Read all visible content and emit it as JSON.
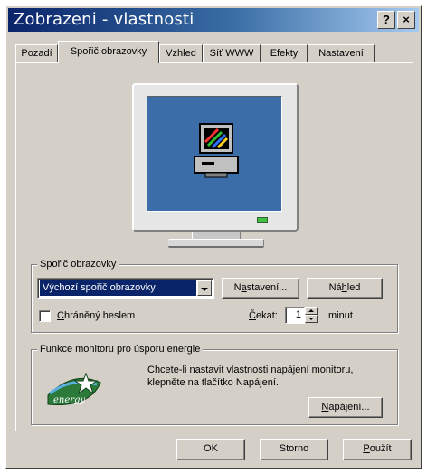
{
  "window": {
    "title": "Zobrazeni - vlastnosti",
    "help_label": "?",
    "close_label": "×"
  },
  "tabs": [
    {
      "label": "Pozadí",
      "active": false
    },
    {
      "label": "Spořič obrazovky",
      "active": true
    },
    {
      "label": "Vzhled",
      "active": false
    },
    {
      "label": "Síť WWW",
      "active": false
    },
    {
      "label": "Efekty",
      "active": false
    },
    {
      "label": "Nastavení",
      "active": false
    }
  ],
  "screensaver": {
    "group_label": "Spořič obrazovky",
    "selected": "Výchozí spořič obrazovky",
    "settings_button": {
      "pre": "N",
      "ul": "a",
      "post": "stavení..."
    },
    "preview_button": {
      "pre": "Ná",
      "ul": "h",
      "post": "led"
    },
    "password_checkbox": {
      "pre": "",
      "ul": "C",
      "post": "hráněný heslem",
      "checked": false
    },
    "wait_label": {
      "pre": "",
      "ul": "Č",
      "post": "ekat:"
    },
    "wait_value": "1",
    "wait_unit": "minut"
  },
  "energy": {
    "group_label": "Funkce monitoru pro úsporu energie",
    "description_line1": "Chcete-li nastavit vlastnosti napájení monitoru,",
    "description_line2": "klepněte na tlačítko Napájení.",
    "power_button": {
      "pre": "",
      "ul": "N",
      "post": "apájení..."
    },
    "logo_text": "energy"
  },
  "footer": {
    "ok_label": "OK",
    "cancel_label": "Storno",
    "apply_button": {
      "pre": "",
      "ul": "P",
      "post": "oužít"
    }
  },
  "colors": {
    "title_gradient_start": "#0a246a",
    "title_gradient_end": "#a6caf0",
    "dialog_face": "#d4d0c8",
    "selection": "#0a246a",
    "desktop_preview": "#3b6ea8"
  }
}
